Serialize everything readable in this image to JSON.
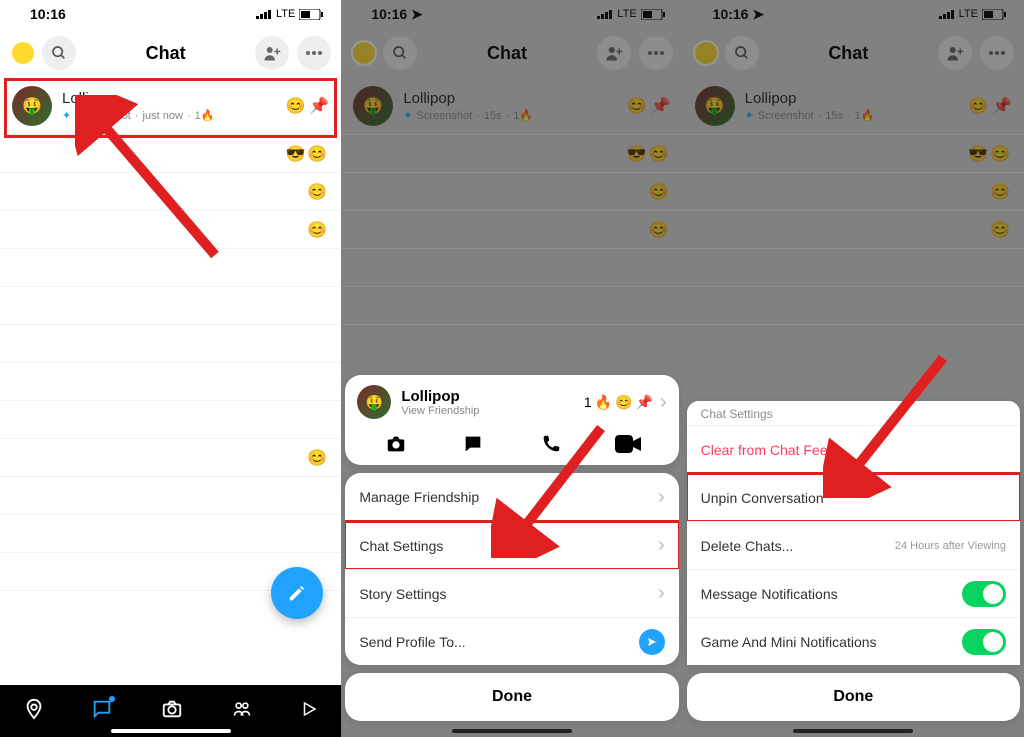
{
  "status": {
    "time": "10:16",
    "signal": "LTE"
  },
  "header": {
    "title": "Chat"
  },
  "contact": {
    "name": "Lollipop",
    "status_label": "Screenshot",
    "time1": "just now",
    "time2": "15s",
    "streak": "1🔥",
    "card_sub": "View Friendship",
    "card_meta": "1"
  },
  "menu2": {
    "manage": "Manage Friendship",
    "chat_settings": "Chat Settings",
    "story_settings": "Story Settings",
    "send_profile": "Send Profile To..."
  },
  "menu3": {
    "title": "Chat Settings",
    "clear": "Clear from Chat Feed",
    "unpin": "Unpin Conversation",
    "delete": "Delete Chats...",
    "delete_sub": "24 Hours after Viewing",
    "msg_notif": "Message Notifications",
    "game_notif": "Game And Mini Notifications"
  },
  "done": "Done"
}
